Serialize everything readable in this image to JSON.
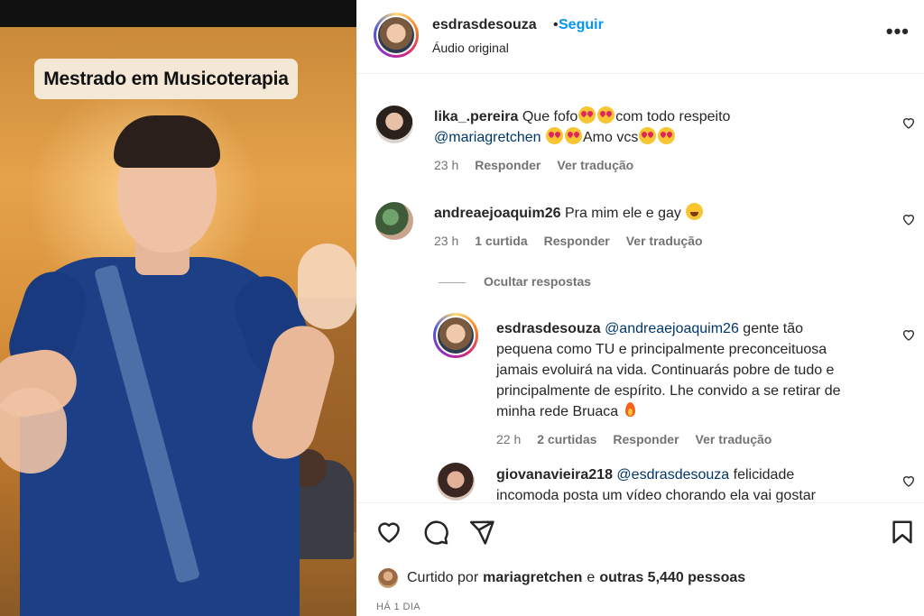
{
  "video": {
    "caption": "Mestrado em Musicoterapia"
  },
  "header": {
    "username": "esdrasdesouza",
    "separator": "•",
    "follow_label": "Seguir",
    "audio_label": "Áudio original",
    "more_label": "•••"
  },
  "comments": [
    {
      "username": "lika_.pereira",
      "text_before_mention": "Que fofo",
      "text_after_emoji": "com todo respeito",
      "mention": "@mariagretchen",
      "text_end": "Amo vcs",
      "time": "23 h",
      "reply_label": "Responder",
      "translate_label": "Ver tradução"
    },
    {
      "username": "andreaejoaquim26",
      "text": "Pra mim ele e gay",
      "time": "23 h",
      "likes": "1 curtida",
      "reply_label": "Responder",
      "translate_label": "Ver tradução"
    }
  ],
  "hide_replies_label": "Ocultar respostas",
  "replies": [
    {
      "username": "esdrasdesouza",
      "mention": "@andreaejoaquim26",
      "line1": " gente tão",
      "line2": "pequena como TU e principalmente preconceituosa",
      "line3": "jamais evoluirá na vida. Continuarás pobre de tudo e",
      "line4": "principalmente de espírito. Lhe convido a se retirar de",
      "line5": "minha rede Bruaca",
      "time": "22 h",
      "likes": "2 curtidas",
      "reply_label": "Responder",
      "translate_label": "Ver tradução"
    },
    {
      "username": "giovanavieira218",
      "mention": "@esdrasdesouza",
      "line1": " felicidade",
      "line2": "incomoda posta um vídeo chorando ela vai gostar"
    }
  ],
  "likes": {
    "prefix": "Curtido por",
    "user": "mariagretchen",
    "middle": "e",
    "others": "outras 5,440 pessoas"
  },
  "timestamp": "HÁ 1 DIA",
  "icons": {
    "like": "heart-icon",
    "comment": "comment-icon",
    "share": "share-icon",
    "save": "bookmark-icon",
    "more": "more-options-icon"
  },
  "colors": {
    "follow_blue": "#0095f6",
    "mention_blue": "#00376b",
    "text_primary": "#262626",
    "text_secondary": "#737373"
  }
}
